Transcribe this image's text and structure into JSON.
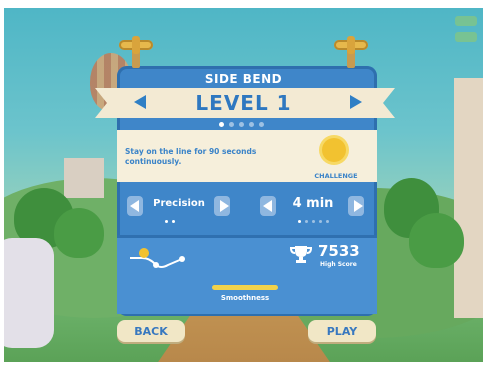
{
  "header": {
    "track_name": "SIDE BEND",
    "level_label": "LEVEL 1"
  },
  "level_pages": {
    "count": 5,
    "active_index": 0
  },
  "challenge": {
    "text": "Stay on the line for 90 seconds continuously.",
    "badge_label": "CHALLENGE",
    "icon": "sun-badge-icon"
  },
  "mode_selector": {
    "value": "Precision",
    "page_count": 2,
    "active_index": 0
  },
  "time_selector": {
    "value": "4 min",
    "page_count": 5,
    "active_index": 0
  },
  "stats": {
    "high_score": "7533",
    "high_score_label": "High Score",
    "smoothness_label": "Smoothness",
    "smoothness_level": 1.0
  },
  "actions": {
    "back_label": "BACK",
    "play_label": "PLAY"
  },
  "colors": {
    "panel_blue": "#3f86c9",
    "accent_blue": "#2f78c0",
    "cream": "#f3ead3",
    "smoothness_yellow": "#f2d24a"
  }
}
